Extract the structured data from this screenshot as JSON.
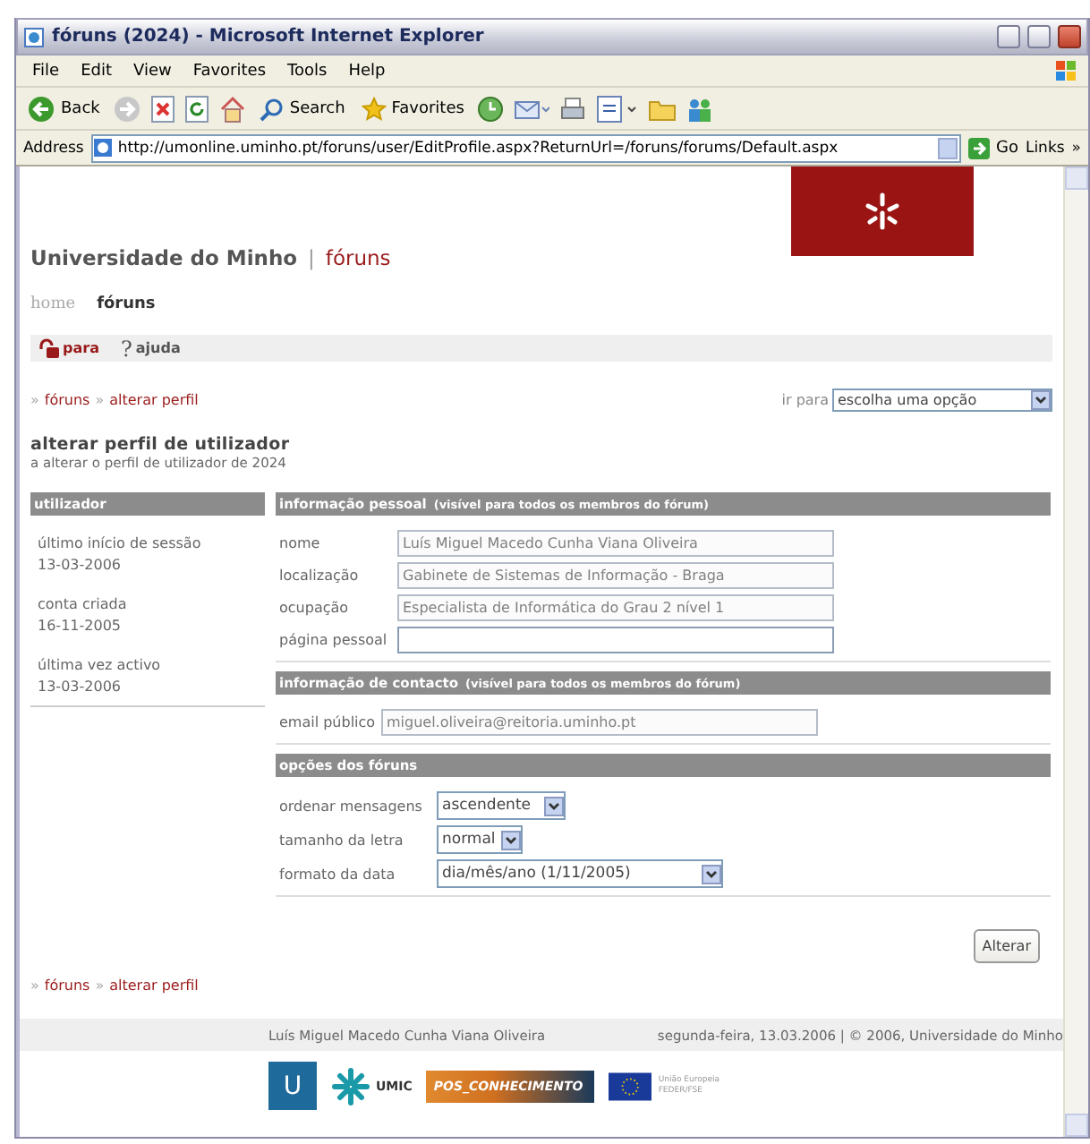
{
  "window": {
    "title": "fóruns (2024) - Microsoft Internet Explorer"
  },
  "menu": [
    {
      "label": "File"
    },
    {
      "label": "Edit"
    },
    {
      "label": "View"
    },
    {
      "label": "Favorites"
    },
    {
      "label": "Tools"
    },
    {
      "label": "Help"
    }
  ],
  "toolbar": [
    {
      "kind": "back",
      "label": "Back"
    },
    {
      "kind": "forward"
    },
    {
      "kind": "stop"
    },
    {
      "kind": "refresh"
    },
    {
      "kind": "home"
    },
    {
      "kind": "search",
      "label": "Search"
    },
    {
      "kind": "favorites",
      "label": "Favorites"
    },
    {
      "kind": "history"
    },
    {
      "kind": "mail"
    },
    {
      "kind": "print"
    },
    {
      "kind": "edit"
    },
    {
      "kind": "folder"
    },
    {
      "kind": "messenger"
    }
  ],
  "address": {
    "label": "Address",
    "url": "http://umonline.uminho.pt/foruns/user/EditProfile.aspx?ReturnUrl=/foruns/forums/Default.aspx",
    "go": "Go",
    "links": "Links",
    "more": "»"
  },
  "site": {
    "name": "Universidade do Minho",
    "separator": "|",
    "section": "fóruns"
  },
  "nav": [
    {
      "label": "home",
      "selected": false
    },
    {
      "label": "fóruns",
      "selected": true
    }
  ],
  "actions": [
    {
      "kind": "lock",
      "label": "para"
    },
    {
      "kind": "help",
      "icon": "?",
      "label": "ajuda"
    }
  ],
  "breadcrumb": {
    "separator": "»",
    "items": [
      {
        "label": "fóruns"
      },
      {
        "label": "alterar perfil"
      }
    ]
  },
  "goto": {
    "label": "ir para",
    "value": "escolha uma opção"
  },
  "heading": "alterar perfil de utilizador",
  "subheading": "a alterar o perfil de utilizador de 2024",
  "sidebar": {
    "title": "utilizador",
    "items": [
      {
        "label": "último início de sessão",
        "value": "13-03-2006"
      },
      {
        "label": "conta criada",
        "value": "16-11-2005"
      },
      {
        "label": "última vez activo",
        "value": "13-03-2006"
      }
    ]
  },
  "sections": [
    {
      "title": "informação pessoal",
      "note": "(visível para todos os membros do fórum)",
      "fields": [
        {
          "kind": "text",
          "label": "nome",
          "value": "Luís Miguel Macedo Cunha Viana Oliveira",
          "disabled": true
        },
        {
          "kind": "text",
          "label": "localização",
          "value": "Gabinete de Sistemas de Informação - Braga",
          "disabled": true
        },
        {
          "kind": "text",
          "label": "ocupação",
          "value": "Especialista de Informática do Grau 2 nível 1",
          "disabled": true
        },
        {
          "kind": "text",
          "label": "página pessoal",
          "disabled": false
        }
      ]
    },
    {
      "title": "informação de contacto",
      "note": "(visível para todos os membros do fórum)",
      "fields": [
        {
          "kind": "text",
          "label": "email público",
          "value": "miguel.oliveira@reitoria.uminho.pt",
          "disabled": true
        }
      ]
    },
    {
      "title": "opções dos fóruns",
      "fields": [
        {
          "kind": "select",
          "label": "ordenar mensagens",
          "value": "ascendente"
        },
        {
          "kind": "select",
          "label": "tamanho da letra",
          "value": "normal"
        },
        {
          "kind": "select",
          "label": "formato da data",
          "value": "dia/mês/ano (1/11/2005)"
        }
      ]
    }
  ],
  "submit": "Alterar",
  "bottom_breadcrumb": {
    "separator": "»",
    "items": [
      {
        "label": "fóruns"
      },
      {
        "label": "alterar perfil"
      }
    ]
  },
  "footer": {
    "user": "Luís Miguel Macedo Cunha Viana Oliveira",
    "date": "segunda-feira, 13.03.2006 | © 2006, Universidade do Minho"
  },
  "sponsors": [
    {
      "kind": "uminho",
      "label": "U"
    },
    {
      "kind": "umic",
      "label": "UMIC"
    },
    {
      "kind": "pos",
      "label": "POS_CONHECIMENTO"
    },
    {
      "kind": "eu",
      "label": "União Europeia FEDER/FSE"
    }
  ]
}
